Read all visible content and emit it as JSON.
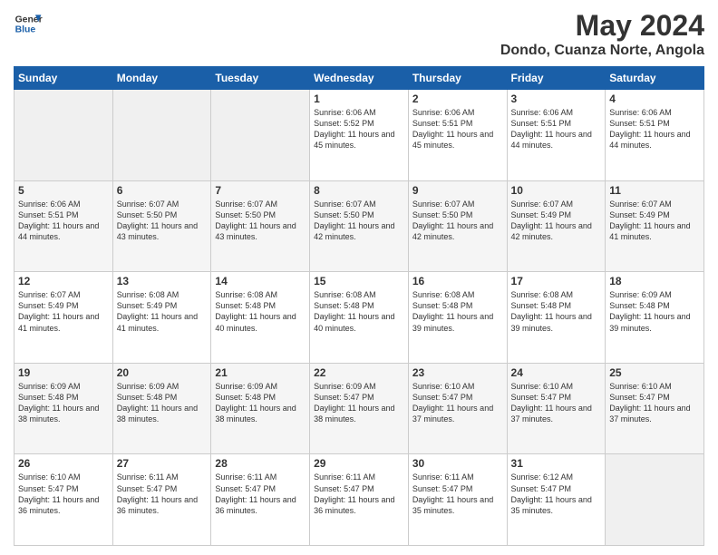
{
  "header": {
    "logo_line1": "General",
    "logo_line2": "Blue",
    "main_title": "May 2024",
    "subtitle": "Dondo, Cuanza Norte, Angola"
  },
  "days_of_week": [
    "Sunday",
    "Monday",
    "Tuesday",
    "Wednesday",
    "Thursday",
    "Friday",
    "Saturday"
  ],
  "weeks": [
    [
      {
        "day": "",
        "text": ""
      },
      {
        "day": "",
        "text": ""
      },
      {
        "day": "",
        "text": ""
      },
      {
        "day": "1",
        "text": "Sunrise: 6:06 AM\nSunset: 5:52 PM\nDaylight: 11 hours and 45 minutes."
      },
      {
        "day": "2",
        "text": "Sunrise: 6:06 AM\nSunset: 5:51 PM\nDaylight: 11 hours and 45 minutes."
      },
      {
        "day": "3",
        "text": "Sunrise: 6:06 AM\nSunset: 5:51 PM\nDaylight: 11 hours and 44 minutes."
      },
      {
        "day": "4",
        "text": "Sunrise: 6:06 AM\nSunset: 5:51 PM\nDaylight: 11 hours and 44 minutes."
      }
    ],
    [
      {
        "day": "5",
        "text": "Sunrise: 6:06 AM\nSunset: 5:51 PM\nDaylight: 11 hours and 44 minutes."
      },
      {
        "day": "6",
        "text": "Sunrise: 6:07 AM\nSunset: 5:50 PM\nDaylight: 11 hours and 43 minutes."
      },
      {
        "day": "7",
        "text": "Sunrise: 6:07 AM\nSunset: 5:50 PM\nDaylight: 11 hours and 43 minutes."
      },
      {
        "day": "8",
        "text": "Sunrise: 6:07 AM\nSunset: 5:50 PM\nDaylight: 11 hours and 42 minutes."
      },
      {
        "day": "9",
        "text": "Sunrise: 6:07 AM\nSunset: 5:50 PM\nDaylight: 11 hours and 42 minutes."
      },
      {
        "day": "10",
        "text": "Sunrise: 6:07 AM\nSunset: 5:49 PM\nDaylight: 11 hours and 42 minutes."
      },
      {
        "day": "11",
        "text": "Sunrise: 6:07 AM\nSunset: 5:49 PM\nDaylight: 11 hours and 41 minutes."
      }
    ],
    [
      {
        "day": "12",
        "text": "Sunrise: 6:07 AM\nSunset: 5:49 PM\nDaylight: 11 hours and 41 minutes."
      },
      {
        "day": "13",
        "text": "Sunrise: 6:08 AM\nSunset: 5:49 PM\nDaylight: 11 hours and 41 minutes."
      },
      {
        "day": "14",
        "text": "Sunrise: 6:08 AM\nSunset: 5:48 PM\nDaylight: 11 hours and 40 minutes."
      },
      {
        "day": "15",
        "text": "Sunrise: 6:08 AM\nSunset: 5:48 PM\nDaylight: 11 hours and 40 minutes."
      },
      {
        "day": "16",
        "text": "Sunrise: 6:08 AM\nSunset: 5:48 PM\nDaylight: 11 hours and 39 minutes."
      },
      {
        "day": "17",
        "text": "Sunrise: 6:08 AM\nSunset: 5:48 PM\nDaylight: 11 hours and 39 minutes."
      },
      {
        "day": "18",
        "text": "Sunrise: 6:09 AM\nSunset: 5:48 PM\nDaylight: 11 hours and 39 minutes."
      }
    ],
    [
      {
        "day": "19",
        "text": "Sunrise: 6:09 AM\nSunset: 5:48 PM\nDaylight: 11 hours and 38 minutes."
      },
      {
        "day": "20",
        "text": "Sunrise: 6:09 AM\nSunset: 5:48 PM\nDaylight: 11 hours and 38 minutes."
      },
      {
        "day": "21",
        "text": "Sunrise: 6:09 AM\nSunset: 5:48 PM\nDaylight: 11 hours and 38 minutes."
      },
      {
        "day": "22",
        "text": "Sunrise: 6:09 AM\nSunset: 5:47 PM\nDaylight: 11 hours and 38 minutes."
      },
      {
        "day": "23",
        "text": "Sunrise: 6:10 AM\nSunset: 5:47 PM\nDaylight: 11 hours and 37 minutes."
      },
      {
        "day": "24",
        "text": "Sunrise: 6:10 AM\nSunset: 5:47 PM\nDaylight: 11 hours and 37 minutes."
      },
      {
        "day": "25",
        "text": "Sunrise: 6:10 AM\nSunset: 5:47 PM\nDaylight: 11 hours and 37 minutes."
      }
    ],
    [
      {
        "day": "26",
        "text": "Sunrise: 6:10 AM\nSunset: 5:47 PM\nDaylight: 11 hours and 36 minutes."
      },
      {
        "day": "27",
        "text": "Sunrise: 6:11 AM\nSunset: 5:47 PM\nDaylight: 11 hours and 36 minutes."
      },
      {
        "day": "28",
        "text": "Sunrise: 6:11 AM\nSunset: 5:47 PM\nDaylight: 11 hours and 36 minutes."
      },
      {
        "day": "29",
        "text": "Sunrise: 6:11 AM\nSunset: 5:47 PM\nDaylight: 11 hours and 36 minutes."
      },
      {
        "day": "30",
        "text": "Sunrise: 6:11 AM\nSunset: 5:47 PM\nDaylight: 11 hours and 35 minutes."
      },
      {
        "day": "31",
        "text": "Sunrise: 6:12 AM\nSunset: 5:47 PM\nDaylight: 11 hours and 35 minutes."
      },
      {
        "day": "",
        "text": ""
      }
    ]
  ]
}
